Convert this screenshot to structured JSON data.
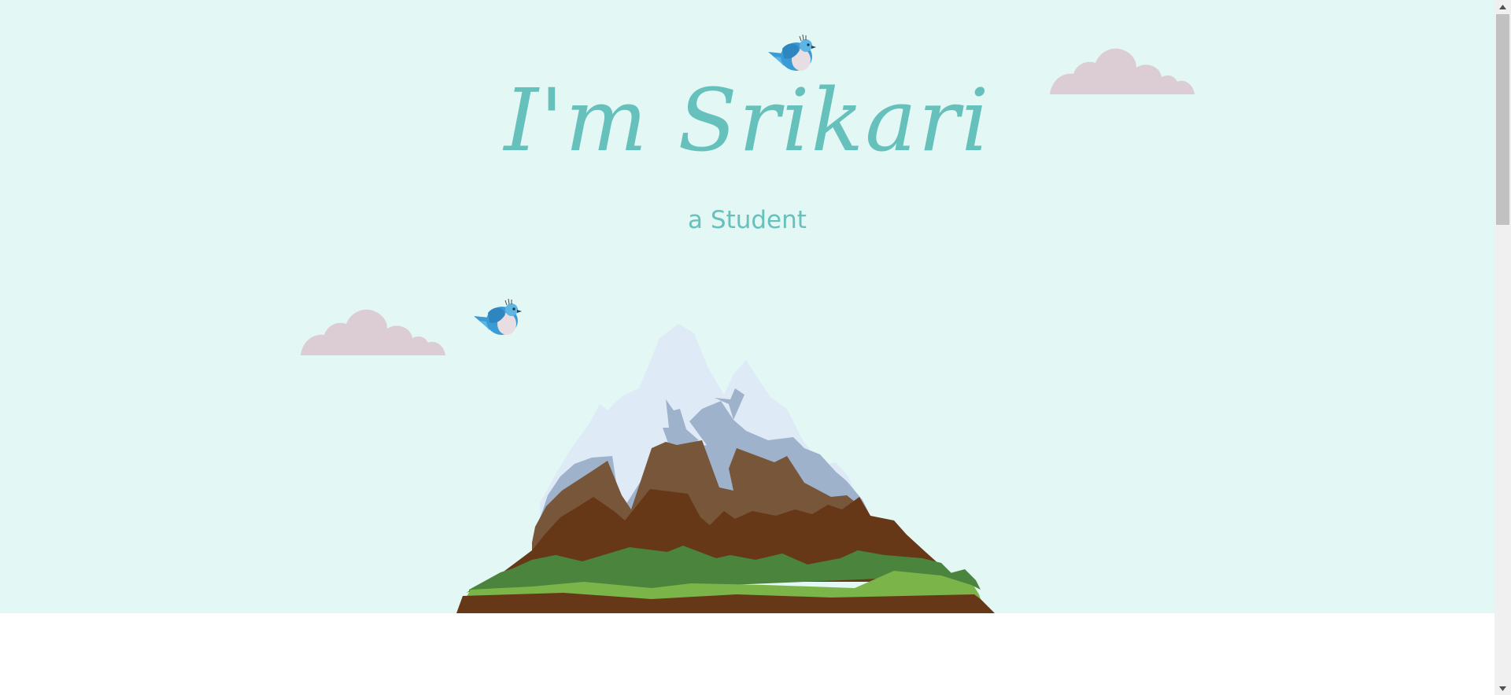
{
  "hero": {
    "title": "I'm Srikari",
    "subtitle": "a Student"
  },
  "colors": {
    "sky": "#e3f7f4",
    "accent": "#66c1bd",
    "cloud": "#dcccd3",
    "bird_blue": "#3a9bd5",
    "snow": "#dfeaf7",
    "rock_shadow": "#9eb2cc",
    "rock": "#78563a",
    "earth": "#663817",
    "grass_dark": "#4b843c",
    "grass_light": "#7bb549"
  },
  "icons": {
    "bird": "bird-icon",
    "cloud": "cloud-icon",
    "mountain": "mountain-illustration",
    "scroll_up": "chevron-up-icon",
    "scroll_down": "chevron-down-icon"
  }
}
